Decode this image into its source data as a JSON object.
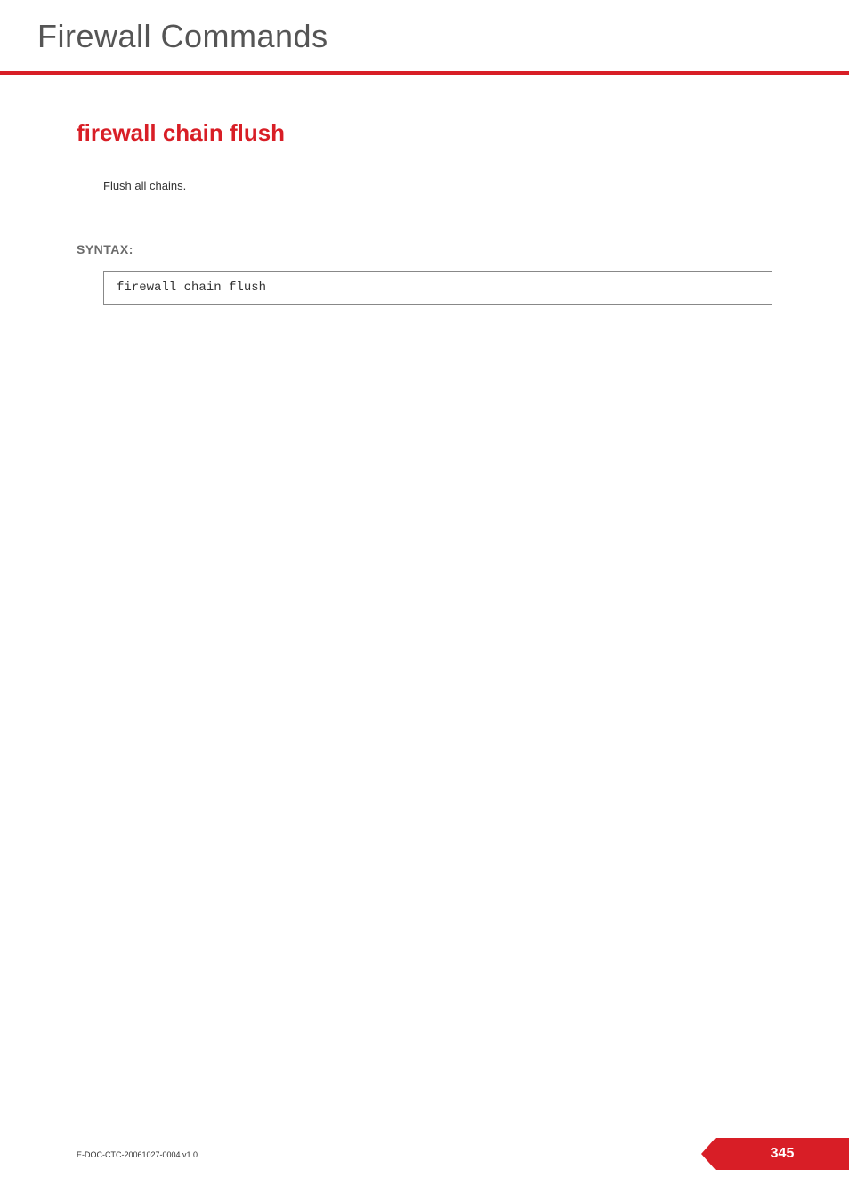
{
  "header": {
    "title": "Firewall Commands"
  },
  "main": {
    "section_title": "firewall chain flush",
    "description": "Flush all chains.",
    "syntax_label": "SYNTAX:",
    "code": "firewall chain flush"
  },
  "footer": {
    "doc_id": "E-DOC-CTC-20061027-0004 v1.0",
    "page_number": "345"
  }
}
